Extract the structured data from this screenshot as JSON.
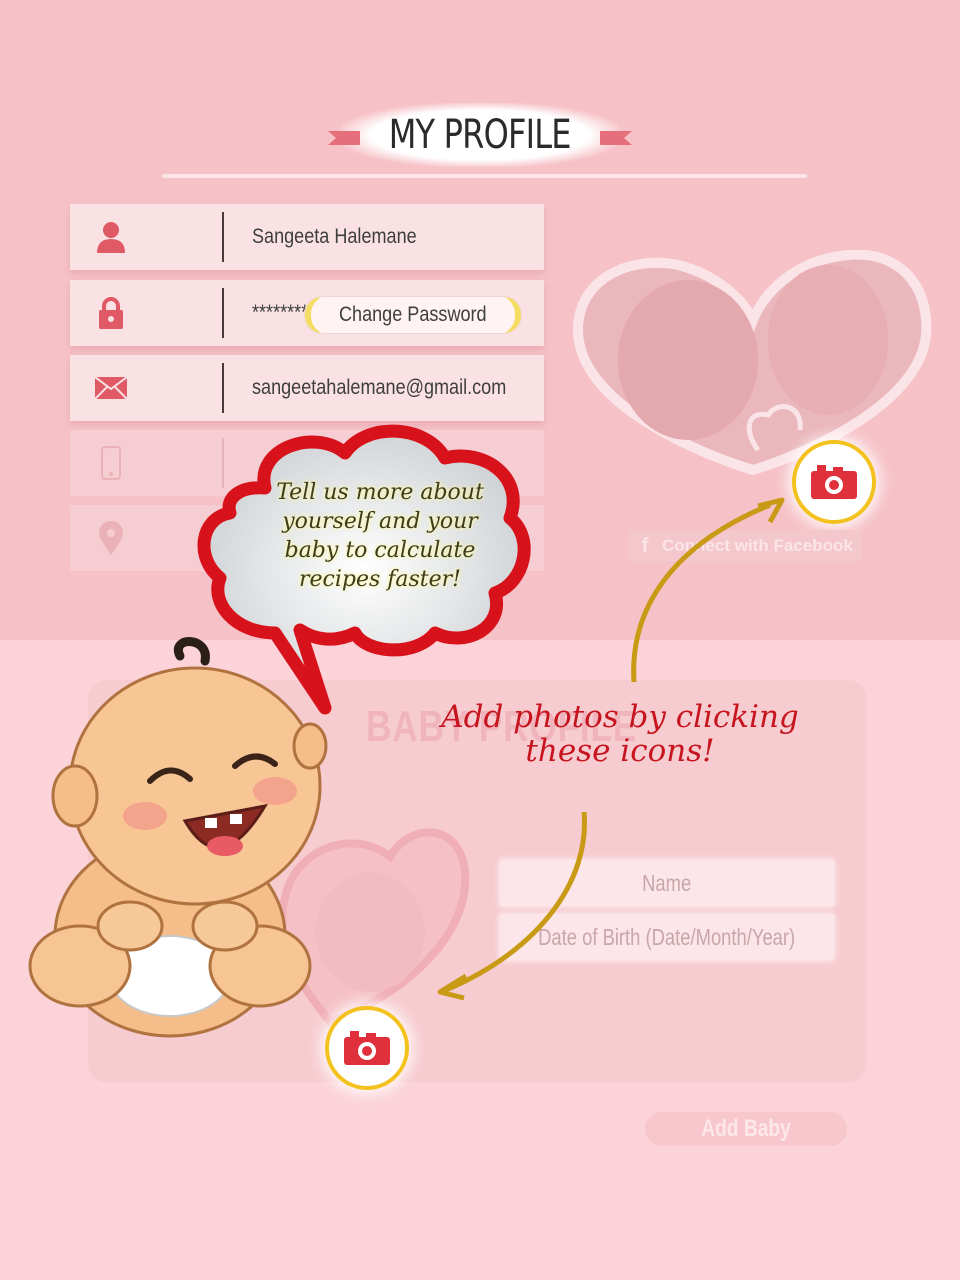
{
  "header": {
    "title": "MY PROFILE"
  },
  "profile": {
    "name": "Sangeeta Halemane",
    "password": "********",
    "change_password_label": "Change Password",
    "email": "sangeetahalemane@gmail.com",
    "phone": "",
    "location": ""
  },
  "social": {
    "facebook_icon": "f",
    "facebook_label": "Connect with Facebook"
  },
  "baby_profile": {
    "heading": "BABY PROFILE",
    "name_placeholder": "Name",
    "dob_placeholder": "Date of Birth (Date/Month/Year)",
    "add_baby_label": "Add Baby"
  },
  "tutorial": {
    "bubble_text": "Tell us more about yourself and your baby to calculate recipes faster!",
    "photo_tip": "Add photos by clicking these icons!"
  },
  "icons": {
    "user": "user-icon",
    "lock": "lock-icon",
    "mail": "mail-icon",
    "phone": "phone-icon",
    "location": "location-pin-icon",
    "camera": "camera-icon"
  },
  "colors": {
    "accent": "#e5707c",
    "camera": "#e0303b",
    "ring": "#f3c21f",
    "tip_text": "#c7151f"
  }
}
